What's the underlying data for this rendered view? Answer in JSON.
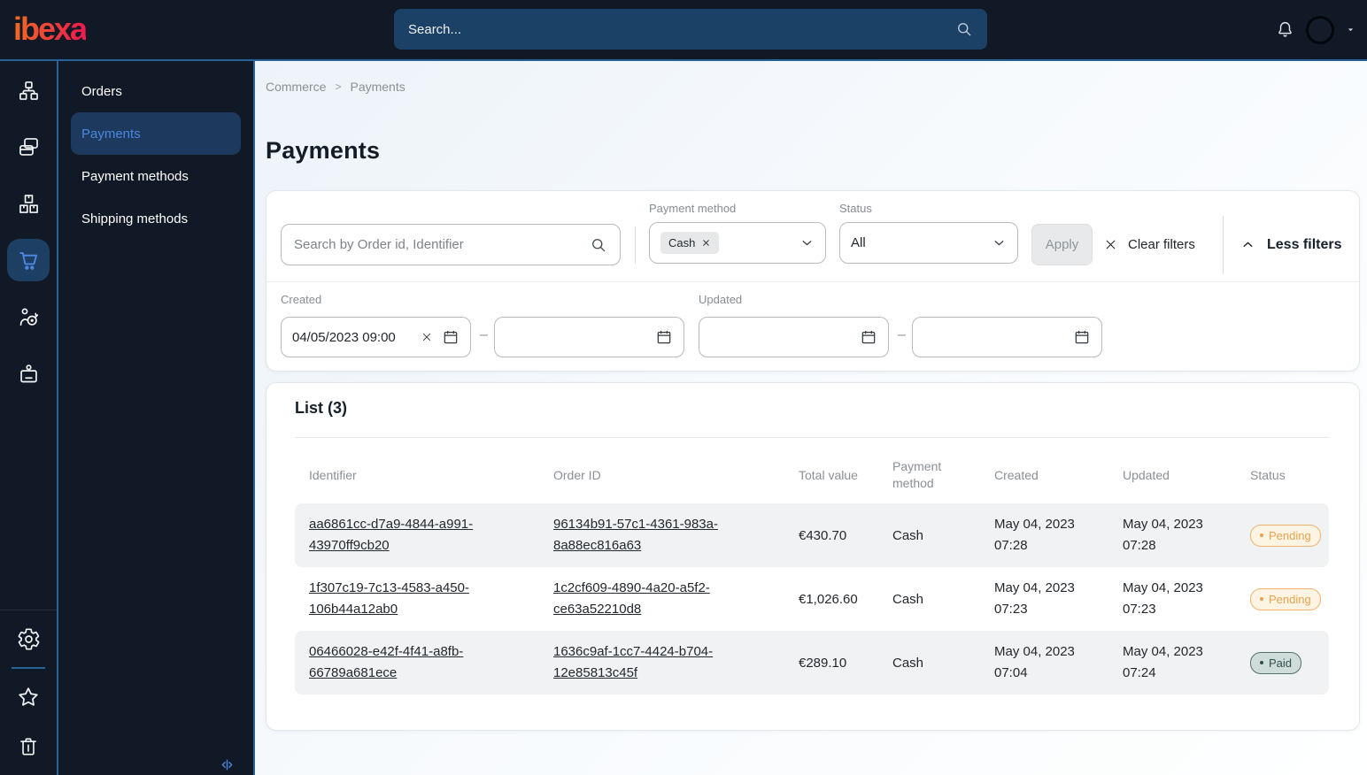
{
  "topbar": {
    "logo": "ibexa",
    "search_placeholder": "Search..."
  },
  "icon_rail": {
    "items": [
      "content-structure",
      "pages",
      "product-catalog",
      "commerce",
      "marketing",
      "customer-profiles"
    ],
    "active_item": "commerce",
    "footer_items": [
      "settings",
      "bookmarks",
      "trash"
    ]
  },
  "sidebar": {
    "items": [
      {
        "label": "Orders",
        "active": false
      },
      {
        "label": "Payments",
        "active": true
      },
      {
        "label": "Payment methods",
        "active": false
      },
      {
        "label": "Shipping methods",
        "active": false
      }
    ]
  },
  "breadcrumb": {
    "items": [
      "Commerce",
      "Payments"
    ],
    "separator": ">"
  },
  "page": {
    "title": "Payments"
  },
  "filters": {
    "search": {
      "placeholder": "Search by Order id, Identifier",
      "value": ""
    },
    "payment_method": {
      "label": "Payment method",
      "selected_chip": "Cash"
    },
    "status": {
      "label": "Status",
      "value": "All"
    },
    "apply_label": "Apply",
    "clear_label": "Clear filters",
    "toggle_label": "Less filters",
    "created": {
      "label": "Created",
      "from": "04/05/2023 09:00",
      "to": ""
    },
    "updated": {
      "label": "Updated",
      "from": "",
      "to": ""
    },
    "range_separator": "–"
  },
  "list": {
    "title": "List (3)",
    "columns": [
      "Identifier",
      "Order ID",
      "Total value",
      "Payment method",
      "Created",
      "Updated",
      "Status"
    ],
    "rows": [
      {
        "identifier": "aa6861cc-d7a9-4844-a991-43970ff9cb20",
        "order_id": "96134b91-57c1-4361-983a-8a88ec816a63",
        "total": "€430.70",
        "method": "Cash",
        "created": "May 04, 2023 07:28",
        "updated": "May 04, 2023 07:28",
        "status": "Pending"
      },
      {
        "identifier": "1f307c19-7c13-4583-a450-106b44a12ab0",
        "order_id": "1c2cf609-4890-4a20-a5f2-ce63a52210d8",
        "total": "€1,026.60",
        "method": "Cash",
        "created": "May 04, 2023 07:23",
        "updated": "May 04, 2023 07:23",
        "status": "Pending"
      },
      {
        "identifier": "06466028-e42f-4f41-a8fb-66789a681ece",
        "order_id": "1636c9af-1cc7-4424-b704-12e85813c45f",
        "total": "€289.10",
        "method": "Cash",
        "created": "May 04, 2023 07:04",
        "updated": "May 04, 2023 07:24",
        "status": "Paid"
      }
    ]
  },
  "colors": {
    "topbar_bg": "#111927",
    "accent_blue": "#4c86dd",
    "border_blue": "#2a6298",
    "search_bg": "#1c4166",
    "badge_pending_text": "#e8a34d",
    "badge_pending_border": "#f2b269",
    "badge_paid_text": "#33504d",
    "badge_paid_bg": "#cedcda",
    "logo_gradient": [
      "#f26a22",
      "#ee1e4d"
    ]
  }
}
